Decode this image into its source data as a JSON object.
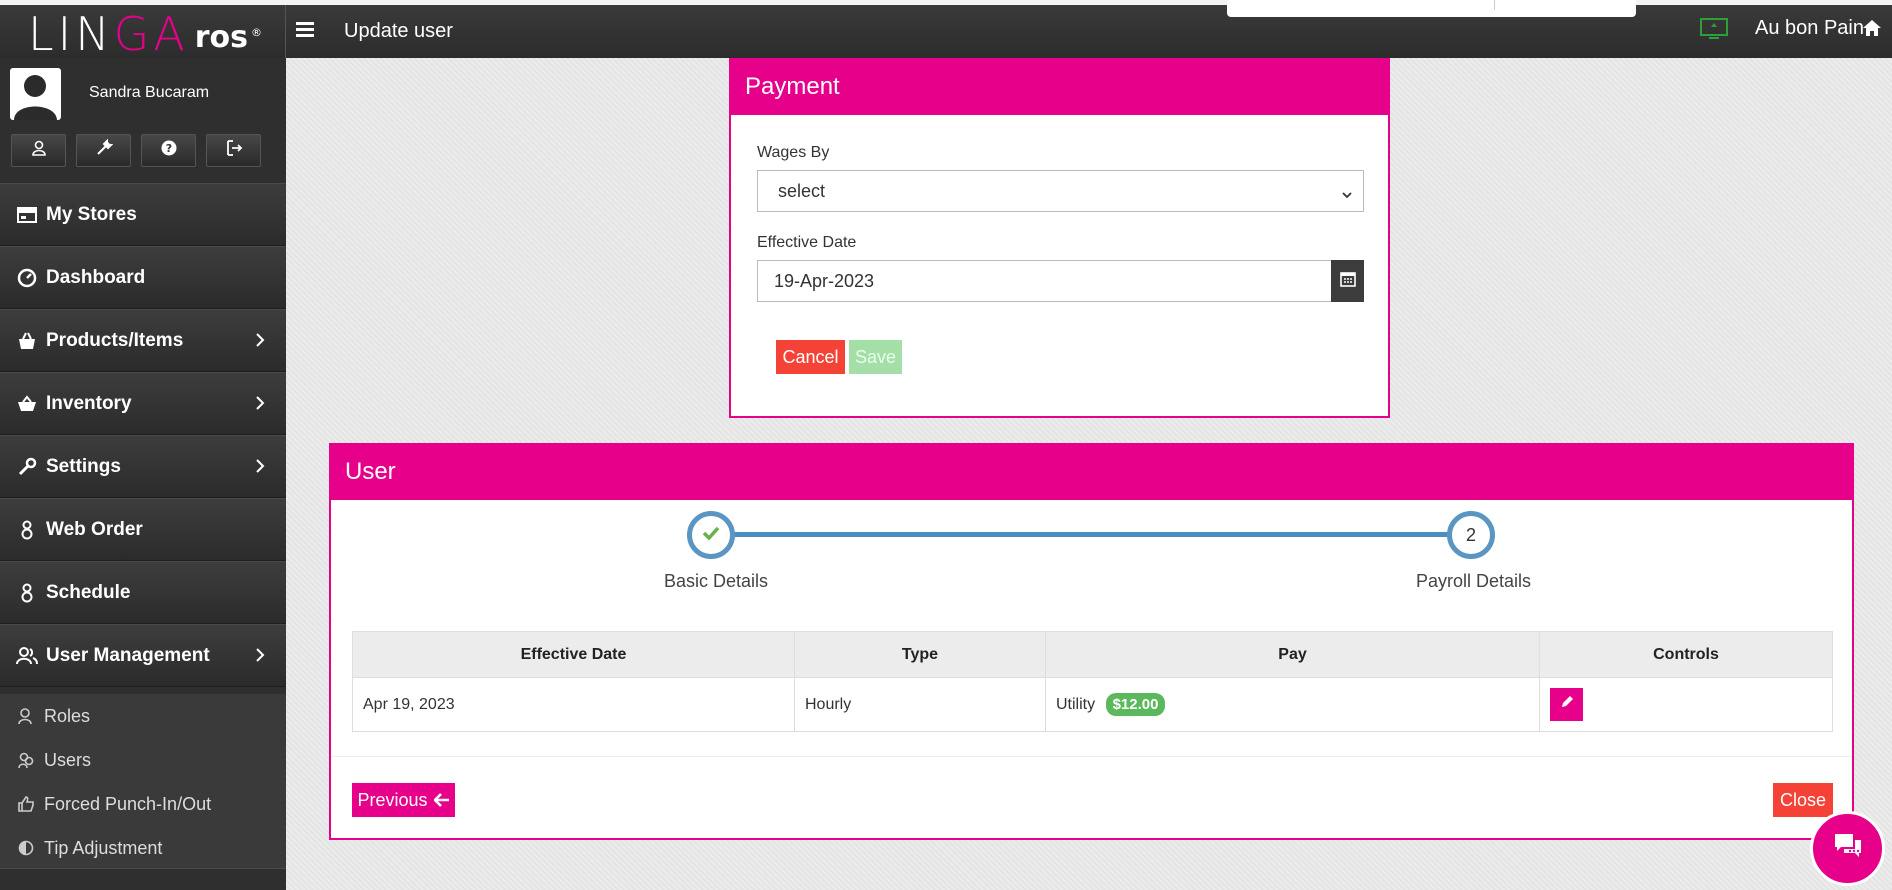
{
  "app": {
    "logo_main": "LIN",
    "logo_accent": "GA",
    "logo_suffix": "ros",
    "logo_reg": "®",
    "page_title": "Update user",
    "store_name": "Au bon Pain",
    "brand_color": "#e6008a"
  },
  "sidebar": {
    "user_name": "Sandra Bucaram",
    "profile_buttons": [
      "user-icon",
      "tools-icon",
      "help-icon",
      "logout-icon"
    ],
    "items": [
      {
        "label": "My Stores",
        "icon": "store-icon",
        "has_children": false
      },
      {
        "label": "Dashboard",
        "icon": "dashboard-icon",
        "has_children": false
      },
      {
        "label": "Products/Items",
        "icon": "basket-icon",
        "has_children": true
      },
      {
        "label": "Inventory",
        "icon": "cart-icon",
        "has_children": true
      },
      {
        "label": "Settings",
        "icon": "wrench-icon",
        "has_children": true
      },
      {
        "label": "Web Order",
        "icon": "web-order-icon",
        "has_children": false
      },
      {
        "label": "Schedule",
        "icon": "schedule-icon",
        "has_children": false
      },
      {
        "label": "User Management",
        "icon": "users-icon",
        "has_children": true
      }
    ],
    "sub_items": [
      {
        "label": "Roles",
        "icon": "role-icon"
      },
      {
        "label": "Users",
        "icon": "users-small-icon"
      },
      {
        "label": "Forced Punch-In/Out",
        "icon": "thumbs-icon"
      },
      {
        "label": "Tip Adjustment",
        "icon": "half-circle-icon"
      }
    ]
  },
  "payment": {
    "title": "Payment",
    "wages_by_label": "Wages By",
    "wages_by_value": "select",
    "effective_date_label": "Effective Date",
    "effective_date_value": "19-Apr-2023",
    "cancel_label": "Cancel",
    "save_label": "Save"
  },
  "user_panel": {
    "title": "User",
    "steps": [
      {
        "label": "Basic Details",
        "marker": "✔",
        "done": true
      },
      {
        "label": "Payroll Details",
        "marker": "2",
        "done": false
      }
    ],
    "table": {
      "headers": [
        "Effective Date",
        "Type",
        "Pay",
        "Controls"
      ],
      "rows": [
        {
          "effective_date": "Apr 19, 2023",
          "type": "Hourly",
          "pay_label": "Utility",
          "pay_amount": "$12.00"
        }
      ]
    },
    "previous_label": "Previous",
    "close_label": "Close"
  }
}
